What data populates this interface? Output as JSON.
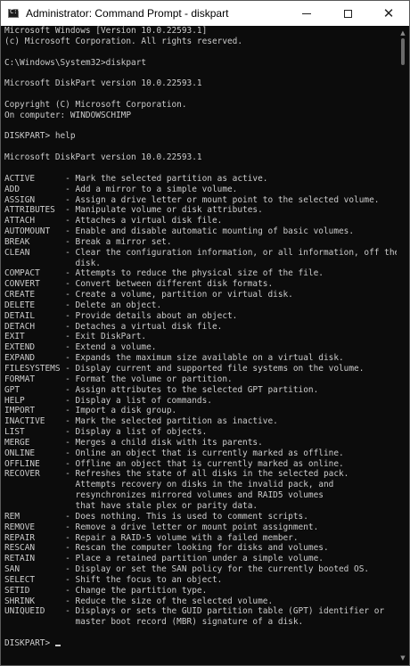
{
  "window": {
    "title": "Administrator: Command Prompt - diskpart",
    "icon_label": "C:\\",
    "icons": {
      "app": "command-prompt-icon",
      "minimize": "minimize-icon",
      "maximize": "maximize-icon",
      "close": "close-icon"
    },
    "close_glyph": "✕"
  },
  "console": {
    "lines": [
      "Microsoft Windows [Version 10.0.22593.1]",
      "(c) Microsoft Corporation. All rights reserved.",
      "",
      "C:\\Windows\\System32>diskpart",
      "",
      "Microsoft DiskPart version 10.0.22593.1",
      "",
      "Copyright (C) Microsoft Corporation.",
      "On computer: WINDOWSCHIMP",
      "",
      "DISKPART> help",
      "",
      "Microsoft DiskPart version 10.0.22593.1",
      "",
      "ACTIVE      - Mark the selected partition as active.",
      "ADD         - Add a mirror to a simple volume.",
      "ASSIGN      - Assign a drive letter or mount point to the selected volume.",
      "ATTRIBUTES  - Manipulate volume or disk attributes.",
      "ATTACH      - Attaches a virtual disk file.",
      "AUTOMOUNT   - Enable and disable automatic mounting of basic volumes.",
      "BREAK       - Break a mirror set.",
      "CLEAN       - Clear the configuration information, or all information, off the",
      "              disk.",
      "COMPACT     - Attempts to reduce the physical size of the file.",
      "CONVERT     - Convert between different disk formats.",
      "CREATE      - Create a volume, partition or virtual disk.",
      "DELETE      - Delete an object.",
      "DETAIL      - Provide details about an object.",
      "DETACH      - Detaches a virtual disk file.",
      "EXIT        - Exit DiskPart.",
      "EXTEND      - Extend a volume.",
      "EXPAND      - Expands the maximum size available on a virtual disk.",
      "FILESYSTEMS - Display current and supported file systems on the volume.",
      "FORMAT      - Format the volume or partition.",
      "GPT         - Assign attributes to the selected GPT partition.",
      "HELP        - Display a list of commands.",
      "IMPORT      - Import a disk group.",
      "INACTIVE    - Mark the selected partition as inactive.",
      "LIST        - Display a list of objects.",
      "MERGE       - Merges a child disk with its parents.",
      "ONLINE      - Online an object that is currently marked as offline.",
      "OFFLINE     - Offline an object that is currently marked as online.",
      "RECOVER     - Refreshes the state of all disks in the selected pack.",
      "              Attempts recovery on disks in the invalid pack, and",
      "              resynchronizes mirrored volumes and RAID5 volumes",
      "              that have stale plex or parity data.",
      "REM         - Does nothing. This is used to comment scripts.",
      "REMOVE      - Remove a drive letter or mount point assignment.",
      "REPAIR      - Repair a RAID-5 volume with a failed member.",
      "RESCAN      - Rescan the computer looking for disks and volumes.",
      "RETAIN      - Place a retained partition under a simple volume.",
      "SAN         - Display or set the SAN policy for the currently booted OS.",
      "SELECT      - Shift the focus to an object.",
      "SETID       - Change the partition type.",
      "SHRINK      - Reduce the size of the selected volume.",
      "UNIQUEID    - Displays or sets the GUID partition table (GPT) identifier or",
      "              master boot record (MBR) signature of a disk.",
      ""
    ],
    "prompt": "DISKPART>"
  }
}
